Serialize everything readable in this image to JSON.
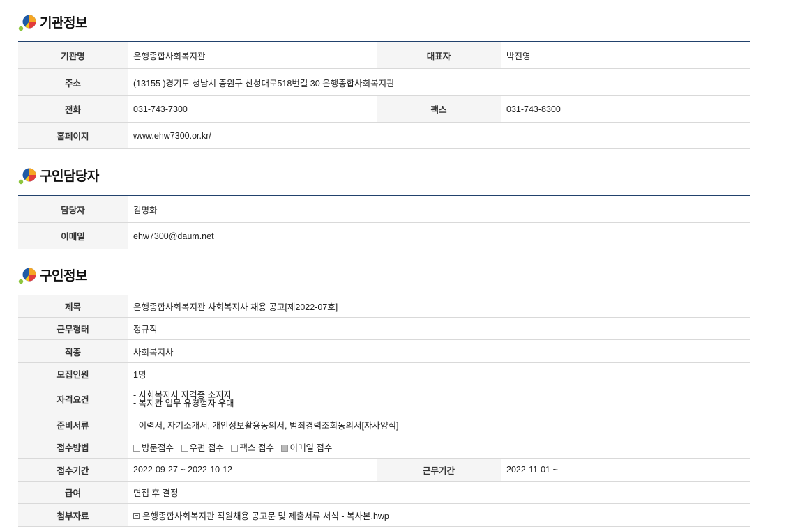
{
  "sections": {
    "org": {
      "title": "기관정보",
      "labels": {
        "name": "기관명",
        "rep": "대표자",
        "address": "주소",
        "phone": "전화",
        "fax": "팩스",
        "homepage": "홈페이지"
      },
      "values": {
        "name": "은행종합사회복지관",
        "rep": "박진영",
        "address": "(13155 )경기도 성남시 중원구 산성대로518번길 30 은행종합사회복지관",
        "phone": "031-743-7300",
        "fax": "031-743-8300",
        "homepage": "www.ehw7300.or.kr/"
      }
    },
    "contact": {
      "title": "구인담당자",
      "labels": {
        "person": "담당자",
        "email": "이메일"
      },
      "values": {
        "person": "김명화",
        "email": "ehw7300@daum.net"
      }
    },
    "job": {
      "title": "구인정보",
      "labels": {
        "subject": "제목",
        "work_type": "근무형태",
        "category": "직종",
        "headcount": "모집인원",
        "requirements": "자격요건",
        "documents": "준비서류",
        "method": "접수방법",
        "period": "접수기간",
        "work_period": "근무기간",
        "salary": "급여",
        "attachment": "첨부자료"
      },
      "values": {
        "subject": "은행종합사회복지관 사회복지사 채용 공고[제2022-07호]",
        "work_type": "정규직",
        "category": "사회복지사",
        "headcount": "1명",
        "requirements": [
          "- 사회복지사 자격증 소지자",
          "- 복지관 업무 유경험자 우대"
        ],
        "documents": "- 이력서, 자기소개서, 개인정보활용동의서, 범죄경력조회동의서[자사양식]",
        "methods": [
          {
            "label": "방문접수",
            "checked": false
          },
          {
            "label": "우편 접수",
            "checked": false
          },
          {
            "label": "팩스 접수",
            "checked": false
          },
          {
            "label": "이메일 접수",
            "checked": true
          }
        ],
        "period": "2022-09-27 ~ 2022-10-12",
        "work_period": "2022-11-01 ~",
        "salary": "면접 후 결정",
        "attachment": "은행종합사회복지관 직원채용 공고문 및 제출서류 서식 - 복사본.hwp"
      }
    }
  }
}
